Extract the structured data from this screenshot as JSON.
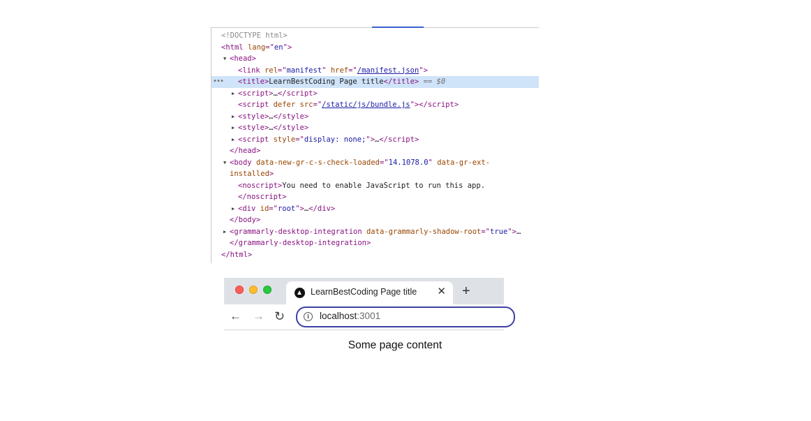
{
  "devtools": {
    "lines": [
      {
        "id": "doctype",
        "text": "<!DOCTYPE html>"
      },
      {
        "id": "html-open",
        "tag": "html",
        "attr": "lang",
        "val": "en"
      },
      {
        "id": "head-open",
        "tag": "head"
      },
      {
        "id": "link",
        "tag": "link",
        "attr1": "rel",
        "val1": "manifest",
        "attr2": "href",
        "val2": "/manifest.json"
      },
      {
        "id": "title",
        "tag": "title",
        "text": "LearnBestCoding Page title",
        "selected_marker": "== $0"
      },
      {
        "id": "script1",
        "tag": "script",
        "ellipsis": "…"
      },
      {
        "id": "script2",
        "tag": "script",
        "attr1": "defer",
        "attr2": "src",
        "val2": "/static/js/bundle.js"
      },
      {
        "id": "style1",
        "tag": "style",
        "ellipsis": "…"
      },
      {
        "id": "style2",
        "tag": "style",
        "ellipsis": "…"
      },
      {
        "id": "script3",
        "tag": "script",
        "attr": "style",
        "val": "display: none;",
        "ellipsis": "…"
      },
      {
        "id": "head-close",
        "tag": "head"
      },
      {
        "id": "body-open",
        "tag": "body",
        "attr1": "data-new-gr-c-s-check-loaded",
        "val1": "14.1078.0",
        "attr2": "data-gr-ext-",
        "attr2_cont": "installed"
      },
      {
        "id": "noscript",
        "tag": "noscript",
        "text": "You need to enable JavaScript to run this app."
      },
      {
        "id": "div-root",
        "tag": "div",
        "attr": "id",
        "val": "root",
        "ellipsis": "…"
      },
      {
        "id": "body-close",
        "tag": "body"
      },
      {
        "id": "grammarly",
        "tag": "grammarly-desktop-integration",
        "attr": "data-grammarly-shadow-root",
        "val": "true",
        "ellipsis": "…"
      },
      {
        "id": "html-close",
        "tag": "html"
      }
    ],
    "row_marker": "•••"
  },
  "browser": {
    "tab_title": "LearnBestCoding Page title",
    "tab_close": "✕",
    "new_tab": "+",
    "back": "←",
    "forward": "→",
    "reload": "↻",
    "info": "i",
    "url_host": "localhost",
    "url_port": ":3001"
  },
  "page": {
    "content": "Some page content"
  }
}
